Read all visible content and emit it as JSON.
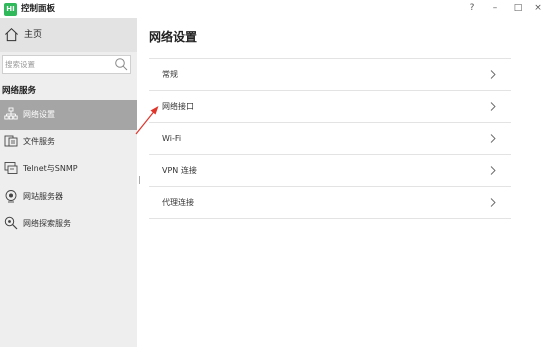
{
  "app": {
    "title": "控制面板",
    "logo_text": "HI",
    "window_buttons": {
      "help": "?",
      "minimize": "–",
      "maximize": "□",
      "close": "×"
    }
  },
  "sidebar": {
    "home_label": "主页",
    "search": {
      "placeholder": "搜索设置",
      "value": ""
    },
    "group_label": "网络服务",
    "items": [
      {
        "label": "网络设置",
        "icon": "network-icon",
        "active": true
      },
      {
        "label": "文件服务",
        "icon": "file-service-icon",
        "active": false
      },
      {
        "label": "Telnet与SNMP",
        "icon": "terminal-icon",
        "active": false
      },
      {
        "label": "网站服务器",
        "icon": "globe-icon",
        "active": false
      },
      {
        "label": "网络探索服务",
        "icon": "discovery-icon",
        "active": false
      }
    ]
  },
  "main": {
    "title": "网络设置",
    "rows": [
      {
        "label": "常规"
      },
      {
        "label": "网络接口"
      },
      {
        "label": "Wi-Fi"
      },
      {
        "label": "VPN 连接"
      },
      {
        "label": "代理连接"
      }
    ]
  },
  "colors": {
    "sidebar_bg": "#eeeeee",
    "active_item_bg": "#a5a5a5",
    "annotation_arrow": "#e0352b",
    "logo": "#2fb95b"
  }
}
